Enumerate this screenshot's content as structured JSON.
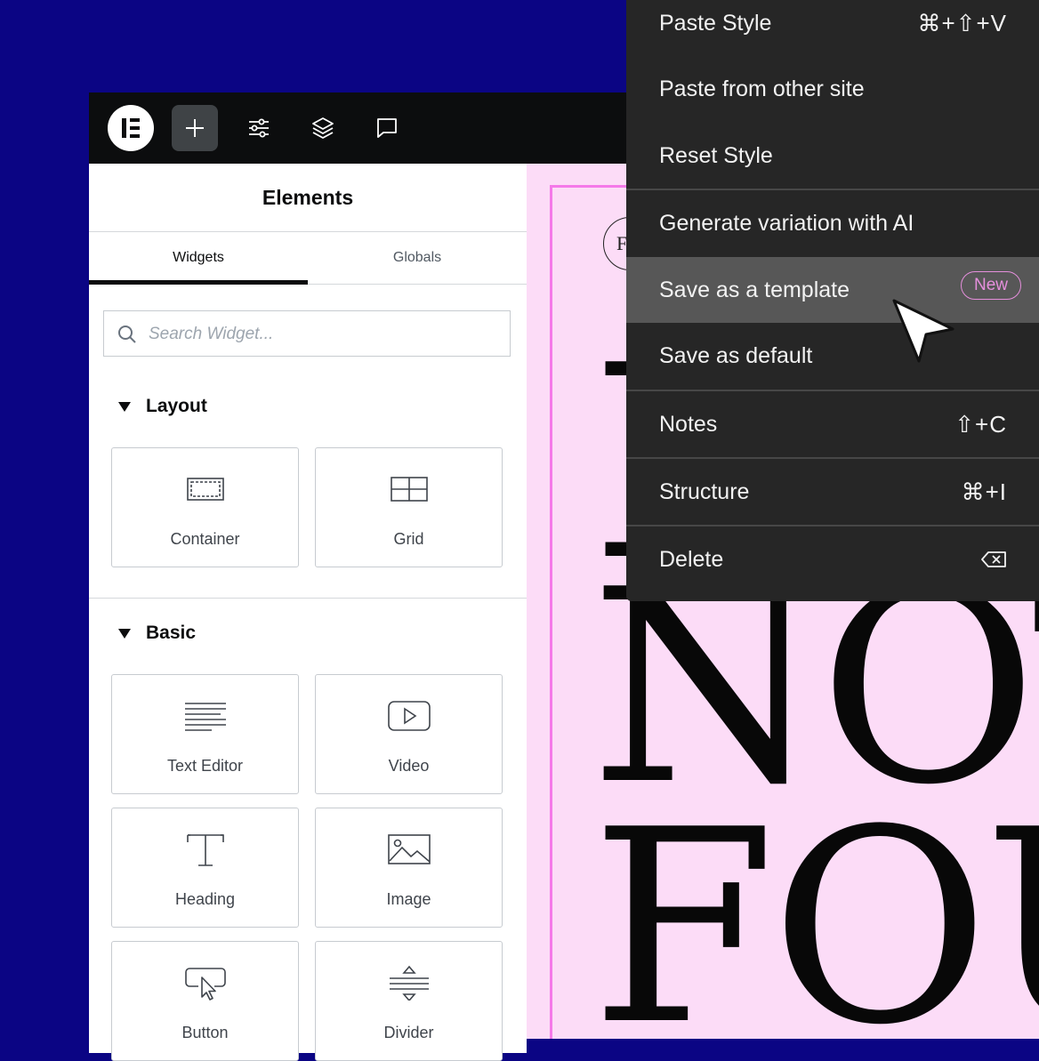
{
  "toolbar": {
    "logo": "elementor-logo",
    "buttons": [
      {
        "name": "add-element",
        "icon": "plus-icon",
        "active": true
      },
      {
        "name": "site-settings",
        "icon": "sliders-icon",
        "active": false
      },
      {
        "name": "structure",
        "icon": "layers-icon",
        "active": false
      },
      {
        "name": "notes",
        "icon": "comment-icon",
        "active": false
      }
    ]
  },
  "panel": {
    "title": "Elements",
    "tabs": [
      {
        "label": "Widgets",
        "active": true
      },
      {
        "label": "Globals",
        "active": false
      }
    ],
    "search": {
      "placeholder": "Search Widget..."
    },
    "sections": [
      {
        "title": "Layout",
        "widgets": [
          {
            "label": "Container",
            "icon": "container-icon"
          },
          {
            "label": "Grid",
            "icon": "grid-icon"
          }
        ]
      },
      {
        "title": "Basic",
        "widgets": [
          {
            "label": "Text Editor",
            "icon": "text-editor-icon"
          },
          {
            "label": "Video",
            "icon": "video-icon"
          },
          {
            "label": "Heading",
            "icon": "heading-icon"
          },
          {
            "label": "Image",
            "icon": "image-icon"
          },
          {
            "label": "Button",
            "icon": "button-icon"
          },
          {
            "label": "Divider",
            "icon": "divider-icon"
          }
        ]
      }
    ]
  },
  "canvas": {
    "badge_letter": "F",
    "lines": [
      "I",
      "NOT",
      "FOUND"
    ],
    "background": "#fcdcf7",
    "frame_color": "#f579e9"
  },
  "context_menu": {
    "items": [
      {
        "label": "Paste Style",
        "shortcut": "⌘+⇧+V"
      },
      {
        "label": "Paste from other site",
        "shortcut": ""
      },
      {
        "label": "Reset Style",
        "shortcut": ""
      },
      {
        "label": "Generate variation with AI",
        "shortcut": ""
      },
      {
        "label": "Save as a template",
        "shortcut": "",
        "badge": "New",
        "highlighted": true
      },
      {
        "label": "Save as default",
        "shortcut": ""
      },
      {
        "label": "Notes",
        "shortcut": "⇧+C"
      },
      {
        "label": "Structure",
        "shortcut": "⌘+I"
      },
      {
        "label": "Delete",
        "shortcut": "delete-key-icon"
      }
    ]
  },
  "colors": {
    "background": "#0b0584",
    "topbar": "#0c0d0e",
    "menu": "#262626",
    "menu_highlight": "#575757",
    "accent_pink": "#e58fdc"
  }
}
